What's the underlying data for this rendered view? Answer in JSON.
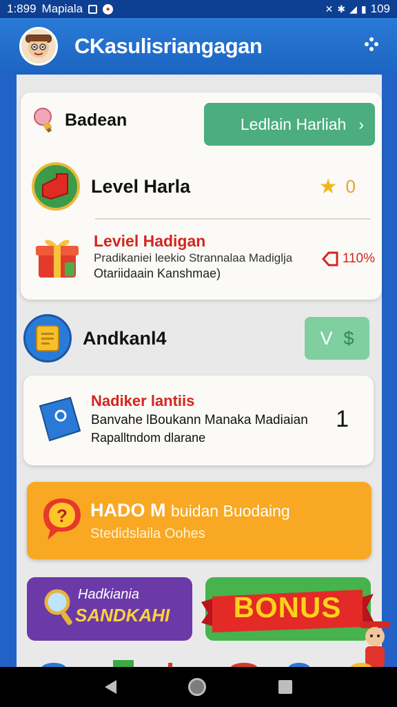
{
  "status_bar": {
    "time": "1:899",
    "carrier": "Mapiala",
    "battery": "109"
  },
  "app_bar": {
    "title": "CKasulisriangagan"
  },
  "header": {
    "title": "Badean",
    "button_label": "Ledlain Harliah",
    "button_arrow": "›"
  },
  "level": {
    "label": "Level Harla",
    "stars": "0"
  },
  "quest": {
    "title": "Leviel Hadigan",
    "line1": "Pradikaniei leekio Strannalaa Madiglja",
    "line2": "Otariidaain Kanshmae)",
    "percent": "110%"
  },
  "andk": {
    "label": "Andkanl4",
    "button_v": "V",
    "button_dollar": "$"
  },
  "book_card": {
    "title": "Nadiker lantiis",
    "line1": "Banvahe lBoukann Manaka Madiaian",
    "line2": "Rapalltndom dlarane",
    "count": "1"
  },
  "orange_card": {
    "title": "HADO M",
    "title_suffix": "buidan Buodaing",
    "subtitle": "Stedidslaila Oohes"
  },
  "purple_card": {
    "top": "Hadkiania",
    "big": "SANDKAHI"
  },
  "bonus_card": {
    "label": "BONUS"
  },
  "colors": {
    "primary_blue": "#1f62c4",
    "green_button": "#4cad7f",
    "red_text": "#d4241d",
    "orange_card": "#f9a823",
    "purple_card": "#6b3aa8",
    "bonus_yellow": "#ffd11c"
  },
  "icons": {
    "app_menu": "dots-menu-icon",
    "level": "red-block-icon",
    "quest": "gift-icon",
    "andk": "card-icon",
    "book": "book-icon",
    "orange": "question-bubble-icon",
    "purple": "magnifier-icon",
    "header": "lightbulb-icon"
  }
}
